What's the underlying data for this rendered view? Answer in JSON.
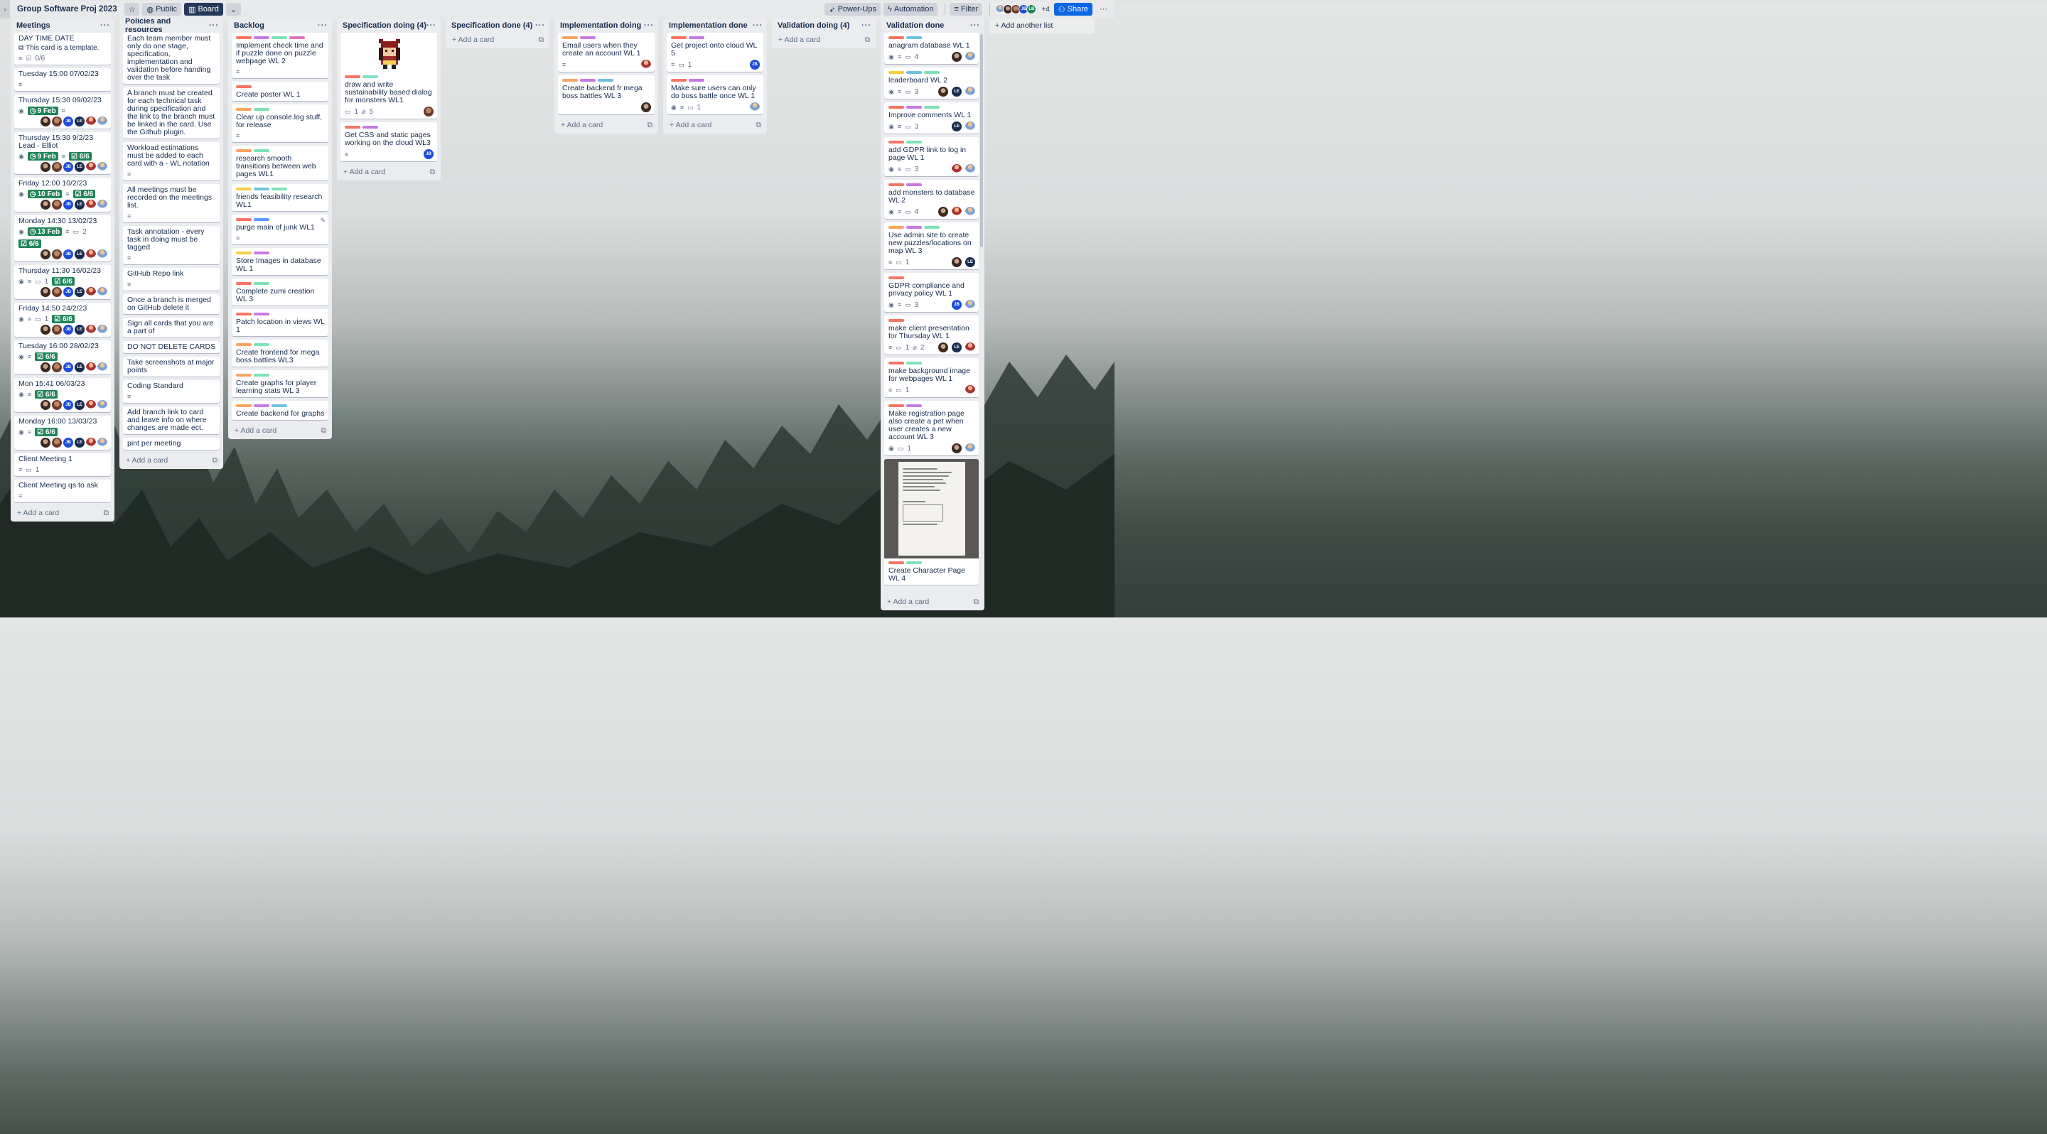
{
  "board": {
    "title": "Group Software Proj 2023",
    "visibility": "Public",
    "view": "Board",
    "power_ups": "Power-Ups",
    "automation": "Automation",
    "filter": "Filter",
    "member_overflow": "+4",
    "share": "Share",
    "add_list": "Add another list"
  },
  "add_card_label": "Add a card",
  "colors": {
    "red": "#f87462",
    "purple": "#c879e6",
    "green": "#7ee2b8",
    "yellow": "#f5cd47",
    "orange": "#fea362",
    "blue": "#6cc3e0",
    "navy": "#579dff",
    "pink": "#e774bb",
    "date_badge": "#1f845a",
    "share_button": "#0c66e4"
  },
  "lists": {
    "meetings": {
      "title": "Meetings",
      "cards": [
        {
          "title": "DAY TIME DATE",
          "template": "This card is a template.",
          "checklist": "0/6"
        },
        {
          "title": "Tuesday 15:00 07/02/23"
        },
        {
          "title": "Thursday 15:30 09/02/23",
          "date": "9 Feb"
        },
        {
          "title": "Thursday 15:30 9/2/23 Lead - Elliot",
          "checklist": "6/6",
          "date": "9 Feb"
        },
        {
          "title": "Friday 12:00 10/2/23",
          "date": "10 Feb",
          "checklist": "6/6"
        },
        {
          "title": "Monday 14:30 13/02/23",
          "date": "13 Feb",
          "comments": "2",
          "checklist": "6/6"
        },
        {
          "title": "Thursday 11:30 16/02/23",
          "comments": "1",
          "checklist": "6/6"
        },
        {
          "title": "Friday 14:50 24/2/23",
          "comments": "1",
          "checklist": "6/6"
        },
        {
          "title": "Tuesday 16:00 28/02/23",
          "checklist": "6/6"
        },
        {
          "title": "Mon 15:41 06/03/23",
          "checklist": "6/6"
        },
        {
          "title": "Monday 16:00 13/03/23",
          "checklist": "6/6"
        },
        {
          "title": "Client Meeting 1",
          "comments": "1"
        },
        {
          "title": "Client Meeting qs to ask"
        }
      ]
    },
    "policies": {
      "title": "Policies and resources",
      "cards": [
        {
          "title": "Each team member must only do one stage, specification, implementation and validation before handing over the task"
        },
        {
          "title": "A branch must be created for each technical task during specification and the link to the branch must be linked in the card. Use the Github plugin."
        },
        {
          "title": "Workload estimations must be added to each card with a - WL notation"
        },
        {
          "title": "All meetings must be recorded on the meetings list."
        },
        {
          "title": "Task annotation - every task in doing must be tagged"
        },
        {
          "title": "GitHub Repo link"
        },
        {
          "title": "Once a branch is merged on GitHub delete it"
        },
        {
          "title": "Sign all cards that you are a part of"
        },
        {
          "title": "DO NOT DELETE CARDS"
        },
        {
          "title": "Take screenshots at major points"
        },
        {
          "title": "Coding Standard"
        },
        {
          "title": "Add branch link to card and leave info on where changes are made ect."
        },
        {
          "title": "pint per meeting"
        }
      ]
    },
    "backlog": {
      "title": "Backlog",
      "cards": [
        {
          "title": "Implement check time and if puzzle done on puzzle webpage WL 2"
        },
        {
          "title": "Create poster WL 1"
        },
        {
          "title": "Clear up console.log stuff, for release"
        },
        {
          "title": "research smooth transitions between web pages WL1"
        },
        {
          "title": "friends feasibility research WL1"
        },
        {
          "title": "purge main of junk WL1"
        },
        {
          "title": "Store Images in database WL 1"
        },
        {
          "title": "Complete zumi creation WL 3"
        },
        {
          "title": "Patch location in views WL 1"
        },
        {
          "title": "Create frontend for mega boss battles WL3"
        },
        {
          "title": "Create graphs for player learning stats WL 3"
        },
        {
          "title": "Create backend for graphs"
        }
      ]
    },
    "spec_doing": {
      "title": "Specification doing (4)",
      "cards": [
        {
          "title": "draw and write sustainability based dialog for monsters WL1",
          "comments": "1",
          "attachments": "5"
        },
        {
          "title": "Get CSS and static pages working on the cloud WL3"
        }
      ]
    },
    "spec_done": {
      "title": "Specification done (4)"
    },
    "impl_doing": {
      "title": "Implementation doing",
      "cards": [
        {
          "title": "Email users when they create an account WL 1"
        },
        {
          "title": "Create backend fr mega boss battles WL 3"
        }
      ]
    },
    "impl_done": {
      "title": "Implementation done",
      "cards": [
        {
          "title": "Get project onto cloud WL 5",
          "comments": "1"
        },
        {
          "title": "Make sure users can only do boss battle once WL 1",
          "comments": "1"
        }
      ]
    },
    "val_doing": {
      "title": "Validation doing (4)"
    },
    "val_done": {
      "title": "Validation done",
      "cards": [
        {
          "title": "anagram database WL 1",
          "comments": "4"
        },
        {
          "title": "leaderboard WL 2",
          "comments": "3"
        },
        {
          "title": "Improve comments WL 1",
          "comments": "3"
        },
        {
          "title": "add GDPR link to log in page WL 1",
          "comments": "3"
        },
        {
          "title": "add monsters to database WL 2",
          "comments": "4"
        },
        {
          "title": "Use admin site to create new puzzles/locations on map WL 3",
          "comments": "1"
        },
        {
          "title": "GDPR compliance and privacy policy WL 1",
          "comments": "3"
        },
        {
          "title": "make client presentation for Thursday WL 1",
          "comments": "1",
          "attachments": "2"
        },
        {
          "title": "make background image for webpages WL 1",
          "comments": "1"
        },
        {
          "title": "Make registration page also create a pet when user creates a new account WL 3",
          "comments": "1"
        },
        {
          "title": "Create Character Page WL 4"
        }
      ]
    }
  },
  "members": {
    "jb": "JB",
    "le": "LE",
    "lb": "LB"
  }
}
